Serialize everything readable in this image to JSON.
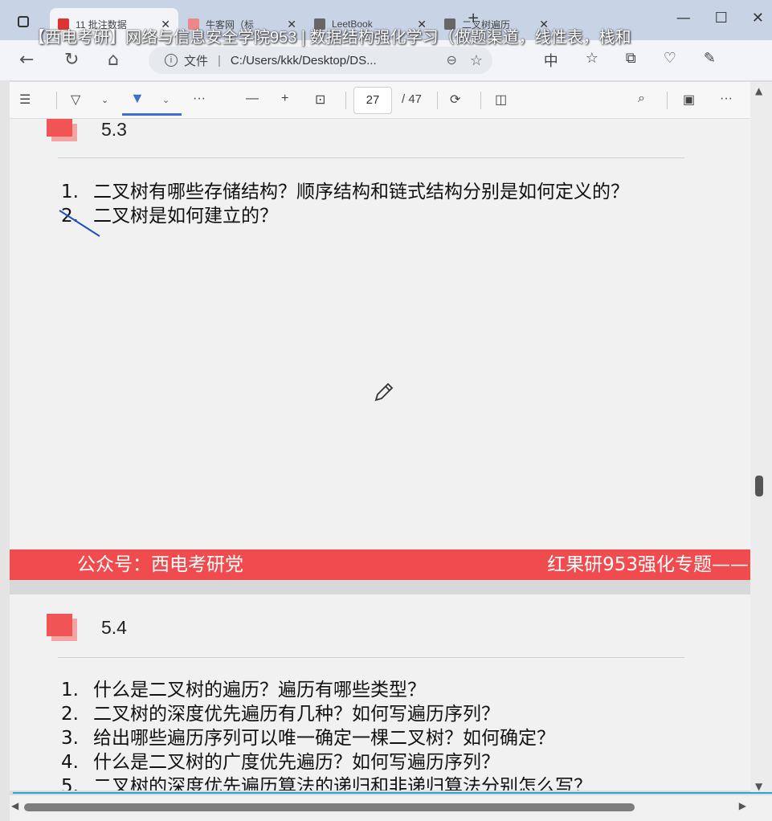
{
  "tabs": [
    {
      "label": "11 批注数据",
      "active": true
    },
    {
      "label": "牛客网（标",
      "active": false
    },
    {
      "label": "LeetBook",
      "active": false
    },
    {
      "label": "二叉树遍历",
      "active": false
    }
  ],
  "video_title": "【西电考研】网络与信息安全学院953 | 数据结构强化学习（做题渠道，线性表，栈和",
  "address_bar": {
    "label": "文件",
    "url": "C:/Users/kkk/Desktop/DS..."
  },
  "pdf_toolbar": {
    "page_current": "27",
    "page_total": "/ 47"
  },
  "sections": [
    {
      "title": "5.3",
      "questions": [
        {
          "num": "1.",
          "text": "二叉树有哪些存储结构？顺序结构和链式结构分别是如何定义的？"
        },
        {
          "num": "2.",
          "text": "二叉树是如何建立的？"
        }
      ]
    },
    {
      "title": "5.4",
      "questions": [
        {
          "num": "1.",
          "text": "什么是二叉树的遍历？遍历有哪些类型？"
        },
        {
          "num": "2.",
          "text": "二叉树的深度优先遍历有几种？如何写遍历序列？"
        },
        {
          "num": "3.",
          "text": "给出哪些遍历序列可以唯一确定一棵二叉树？如何确定？"
        },
        {
          "num": "4.",
          "text": "什么是二叉树的广度优先遍历？如何写遍历序列？"
        },
        {
          "num": "5.",
          "text": "二叉树的深度优先遍历算法的递归和非递归算法分别怎么写？"
        }
      ]
    }
  ],
  "footer_banner": {
    "left": "公众号：西电考研党",
    "right": "红果研953强化专题——"
  },
  "colors": {
    "banner_red": "#f04b4f",
    "marker_red": "#f05454",
    "accent_blue": "#3b6fd0"
  }
}
